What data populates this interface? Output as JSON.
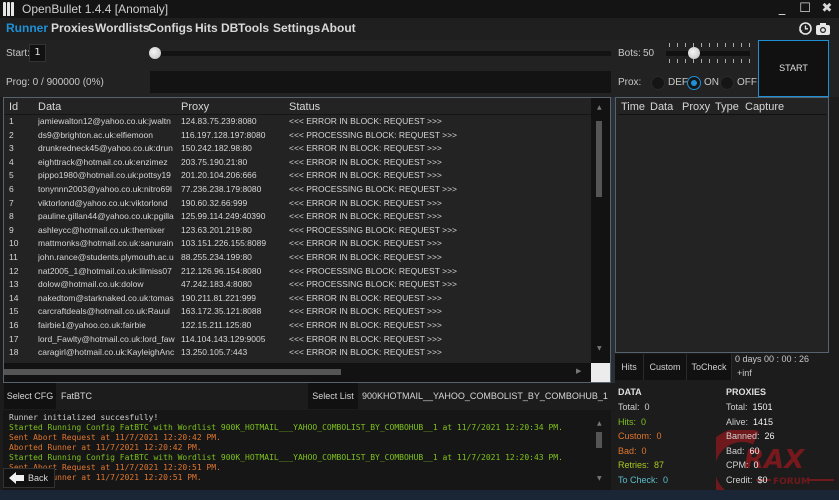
{
  "window": {
    "title": "OpenBullet 1.4.4 [Anomaly]",
    "minimize_glyph": "_",
    "maximize_glyph": "☐",
    "close_glyph": "✖"
  },
  "menu": {
    "items": [
      {
        "label": "Runner",
        "active": true
      },
      {
        "label": "Proxies",
        "active": false
      },
      {
        "label": "Wordlists",
        "active": false
      },
      {
        "label": "Configs",
        "active": false
      },
      {
        "label": "Hits DB",
        "active": false
      },
      {
        "label": "Tools",
        "active": false
      },
      {
        "label": "Settings",
        "active": false
      },
      {
        "label": "About",
        "active": false
      }
    ],
    "icons": [
      "history-icon",
      "camera-icon"
    ]
  },
  "controls": {
    "start_label": "Start:",
    "start_value": "1",
    "progress_label": "Prog: 0 / 900000 (0%)",
    "progress_fraction": 0,
    "bots_label": "Bots:",
    "bots_value": "50",
    "bots_slider_fraction": 0.3,
    "proxies_label": "Prox:",
    "proxy_options": [
      {
        "label": "DEF",
        "selected": false
      },
      {
        "label": "ON",
        "selected": true
      },
      {
        "label": "OFF",
        "selected": false
      }
    ],
    "start_button": "START"
  },
  "grid": {
    "columns": [
      "Id",
      "Data",
      "Proxy",
      "Status"
    ],
    "rows": [
      {
        "id": "1",
        "data": "jamiewalton12@yahoo.co.uk:jwaltn",
        "proxy": "124.83.75.239:8080",
        "status": "<<< ERROR IN BLOCK: REQUEST >>>"
      },
      {
        "id": "2",
        "data": "ds9@brighton.ac.uk:elfiemoon",
        "proxy": "116.197.128.197:8080",
        "status": "<<< PROCESSING BLOCK: REQUEST >>>"
      },
      {
        "id": "3",
        "data": "drunkredneck45@yahoo.co.uk:drun",
        "proxy": "150.242.182.98:80",
        "status": "<<< ERROR IN BLOCK: REQUEST >>>"
      },
      {
        "id": "4",
        "data": "eighttrack@hotmail.co.uk:enzimez",
        "proxy": "203.75.190.21:80",
        "status": "<<< ERROR IN BLOCK: REQUEST >>>"
      },
      {
        "id": "5",
        "data": "pippo1980@hotmail.co.uk:pottsy19",
        "proxy": "201.20.104.206:666",
        "status": "<<< ERROR IN BLOCK: REQUEST >>>"
      },
      {
        "id": "6",
        "data": "tonynnn2003@yahoo.co.uk:nitro69l",
        "proxy": "77.236.238.179:8080",
        "status": "<<< PROCESSING BLOCK: REQUEST >>>"
      },
      {
        "id": "7",
        "data": "viktorlond@yahoo.co.uk:viktorlond",
        "proxy": "190.60.32.66:999",
        "status": "<<< ERROR IN BLOCK: REQUEST >>>"
      },
      {
        "id": "8",
        "data": "pauline.gillan44@yahoo.co.uk:pgilla",
        "proxy": "125.99.114.249:40390",
        "status": "<<< ERROR IN BLOCK: REQUEST >>>"
      },
      {
        "id": "9",
        "data": "ashleycc@hotmail.co.uk:themixer",
        "proxy": "123.63.201.219:80",
        "status": "<<< PROCESSING BLOCK: REQUEST >>>"
      },
      {
        "id": "10",
        "data": "mattmonks@hotmail.co.uk:sanurain",
        "proxy": "103.151.226.155:8089",
        "status": "<<< ERROR IN BLOCK: REQUEST >>>"
      },
      {
        "id": "11",
        "data": "john.rance@students.plymouth.ac.u",
        "proxy": "88.255.234.199:80",
        "status": "<<< ERROR IN BLOCK: REQUEST >>>"
      },
      {
        "id": "12",
        "data": "nat2005_1@hotmail.co.uk:lilmiss07",
        "proxy": "212.126.96.154:8080",
        "status": "<<< PROCESSING BLOCK: REQUEST >>>"
      },
      {
        "id": "13",
        "data": "dolow@hotmail.co.uk:dolow",
        "proxy": "47.242.183.4:8080",
        "status": "<<< PROCESSING BLOCK: REQUEST >>>"
      },
      {
        "id": "14",
        "data": "nakedtom@starknaked.co.uk:tomas",
        "proxy": "190.211.81.221:999",
        "status": "<<< ERROR IN BLOCK: REQUEST >>>"
      },
      {
        "id": "15",
        "data": "carcraftdeals@hotmail.co.uk:Rauul",
        "proxy": "163.172.35.121:8088",
        "status": "<<< ERROR IN BLOCK: REQUEST >>>"
      },
      {
        "id": "16",
        "data": "fairbie1@yahoo.co.uk:fairbie",
        "proxy": "122.15.211.125:80",
        "status": "<<< ERROR IN BLOCK: REQUEST >>>"
      },
      {
        "id": "17",
        "data": "lord_Fawlty@hotmail.co.uk:lord_faw",
        "proxy": "114.104.143.129:9005",
        "status": "<<< ERROR IN BLOCK: REQUEST >>>"
      },
      {
        "id": "18",
        "data": "caragirl@hotmail.co.uk:KayleighAnc",
        "proxy": "13.250.105.7:443",
        "status": "<<< ERROR IN BLOCK: REQUEST >>>"
      }
    ]
  },
  "hits_panel": {
    "columns": [
      "Time",
      "Data",
      "Proxy",
      "Type",
      "Capture"
    ],
    "tabs": [
      "Hits",
      "Custom",
      "ToCheck"
    ],
    "elapsed": "0 days 00 : 00 : 26",
    "cpm_estimate": "+inf"
  },
  "stats": {
    "data_header": "DATA",
    "data": [
      {
        "label": "Total:",
        "value": "0",
        "color": "#d0d0d0"
      },
      {
        "label": "Hits:",
        "value": "0",
        "color": "#7ec21c"
      },
      {
        "label": "Custom:",
        "value": "0",
        "color": "#e0762e"
      },
      {
        "label": "Bad:",
        "value": "0",
        "color": "#e0762e"
      },
      {
        "label": "Retries:",
        "value": "87",
        "color": "#a8c81c"
      },
      {
        "label": "To Check:",
        "value": "0",
        "color": "#5cbdc9"
      }
    ],
    "proxies_header": "PROXIES",
    "proxies": [
      {
        "label": "Total:",
        "value": "1501"
      },
      {
        "label": "Alive:",
        "value": "1415"
      },
      {
        "label": "Banned:",
        "value": "26"
      },
      {
        "label": "Bad:",
        "value": "60"
      },
      {
        "label": "CPM:",
        "value": "0"
      },
      {
        "label": "Credit:",
        "value": "$0"
      }
    ]
  },
  "config": {
    "select_cfg_label": "Select CFG",
    "cfg_value": "FatBTC",
    "select_list_label": "Select List",
    "list_value": "900KHOTMAIL__YAHOO_COMBOLIST_BY_COMBOHUB_1"
  },
  "log": {
    "lines": [
      {
        "text": "Runner initialized succesfully!",
        "color": "#d0d0d0"
      },
      {
        "text": "Started Running Config FatBTC with Wordlist 900K_HOTMAIL___YAHOO_COMBOLIST_BY_COMBOHUB__1 at 11/7/2021 12:20:34 PM.",
        "color": "#7ec21c"
      },
      {
        "text": "Sent Abort Request at 11/7/2021 12:20:42 PM.",
        "color": "#e0762e"
      },
      {
        "text": "Aborted Runner at 11/7/2021 12:20:42 PM.",
        "color": "#e0762e"
      },
      {
        "text": "Started Running Config FatBTC with Wordlist 900K_HOTMAIL___YAHOO_COMBOLIST_BY_COMBOHUB__1 at 11/7/2021 12:20:43 PM.",
        "color": "#7ec21c"
      },
      {
        "text": "Sent Abort Request at 11/7/2021 12:20:51 PM.",
        "color": "#e0762e"
      },
      {
        "text": "Aborted Runner at 11/7/2021 12:20:51 PM.",
        "color": "#e0762e"
      }
    ],
    "back_label": "Back"
  },
  "watermark": {
    "text": "RAX",
    "subtext": "FORUM"
  },
  "colors": {
    "accent": "#1e90d6",
    "background": "#1c1c1c",
    "panel": "#232323"
  }
}
